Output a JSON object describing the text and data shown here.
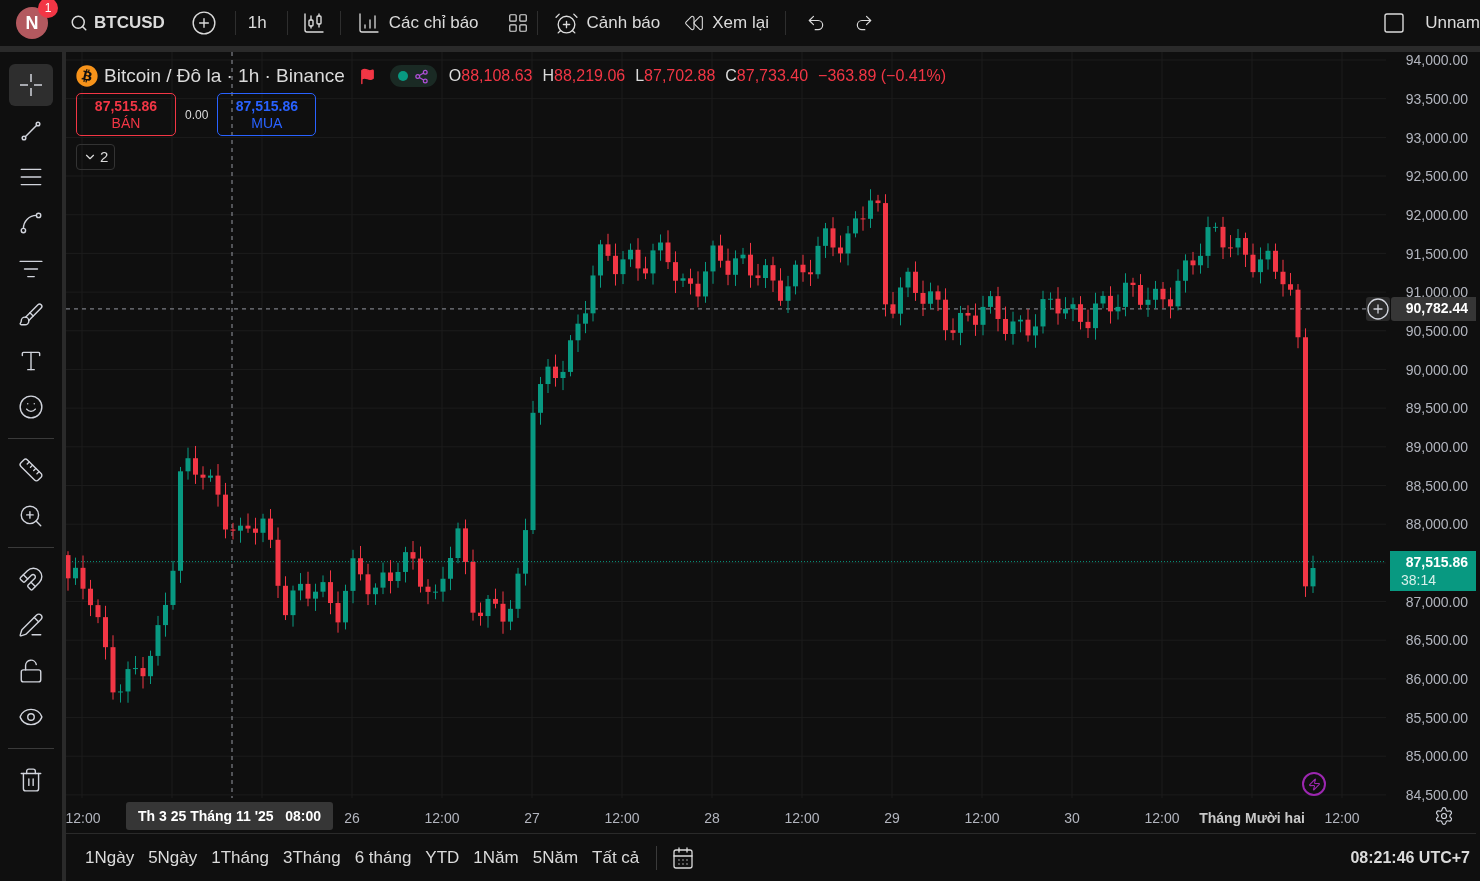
{
  "user": {
    "initial": "N",
    "badge": "1"
  },
  "toolbar": {
    "symbol": "BTCUSD",
    "interval": "1h",
    "indicators": "Các chỉ báo",
    "alerts": "Cảnh báo",
    "replay": "Xem lại",
    "layout_name": "Unnam"
  },
  "tool_groups": [
    [
      {
        "kind": "crosshair",
        "selected": true
      },
      {
        "kind": "trend-line",
        "selected": false
      },
      {
        "kind": "fib",
        "selected": false
      },
      {
        "kind": "pattern",
        "selected": false
      },
      {
        "kind": "forecast",
        "selected": false
      },
      {
        "kind": "brush",
        "selected": false
      },
      {
        "kind": "text",
        "selected": false
      },
      {
        "kind": "emoji",
        "selected": false
      }
    ],
    [
      {
        "kind": "ruler",
        "selected": false
      },
      {
        "kind": "zoom",
        "selected": false
      }
    ],
    [
      {
        "kind": "magnet",
        "selected": false
      },
      {
        "kind": "lock-drawing",
        "selected": false
      },
      {
        "kind": "lock",
        "selected": false
      },
      {
        "kind": "eye",
        "selected": false
      }
    ],
    [
      {
        "kind": "trash",
        "selected": false
      }
    ]
  ],
  "legend": {
    "title": "Bitcoin / Đô la · 1h · Binance",
    "falling": true,
    "ohlc": [
      {
        "label": "O",
        "value": "88,108.63"
      },
      {
        "label": "H",
        "value": "88,219.06"
      },
      {
        "label": "L",
        "value": "87,702.88"
      },
      {
        "label": "C",
        "value": "87,733.40"
      }
    ],
    "change": "−363.89 (−0.41%)"
  },
  "trade": {
    "sell_price": "87,515.86",
    "sell_label": "BÁN",
    "spread": "0.00",
    "buy_price": "87,515.86",
    "buy_label": "MUA"
  },
  "indicators_toggle": "2",
  "price_axis": {
    "ticks": [
      "94,000.00",
      "93,500.00",
      "93,000.00",
      "92,500.00",
      "92,000.00",
      "91,500.00",
      "91,000.00",
      "90,500.00",
      "90,000.00",
      "89,500.00",
      "89,000.00",
      "88,500.00",
      "88,000.00",
      "87,000.00",
      "86,500.00",
      "86,000.00",
      "85,500.00",
      "85,000.00",
      "84,500.00"
    ],
    "crosshair_price": "90,782.44",
    "last_price": "87,515.86",
    "countdown": "38:14"
  },
  "time_axis": {
    "crosshair_time": "Th 3 25 Tháng 11 '25   08:00",
    "labels": [
      {
        "text": "12:00",
        "kind": "time"
      },
      {
        "text": "26",
        "kind": "day"
      },
      {
        "text": "12:00",
        "kind": "time"
      },
      {
        "text": "27",
        "kind": "day"
      },
      {
        "text": "12:00",
        "kind": "time"
      },
      {
        "text": "28",
        "kind": "day"
      },
      {
        "text": "12:00",
        "kind": "time"
      },
      {
        "text": "29",
        "kind": "day"
      },
      {
        "text": "12:00",
        "kind": "time"
      },
      {
        "text": "30",
        "kind": "day"
      },
      {
        "text": "12:00",
        "kind": "time"
      },
      {
        "text": "Tháng Mười hai",
        "kind": "month"
      },
      {
        "text": "12:00",
        "kind": "time"
      }
    ]
  },
  "ranges": [
    "1Ngày",
    "5Ngày",
    "1Tháng",
    "3Tháng",
    "6 tháng",
    "YTD",
    "1Năm",
    "5Năm",
    "Tất cả"
  ],
  "clock": "08:21:46 UTC+7"
}
